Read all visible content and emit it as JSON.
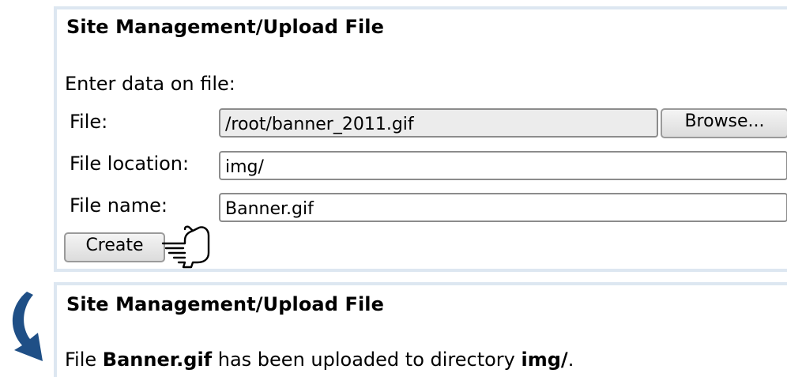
{
  "upload_panel": {
    "title": "Site Management/Upload File",
    "intro": "Enter data on file:",
    "file_label": "File:",
    "file_value": "/root/banner_2011.gif",
    "browse_label": "Browse...",
    "location_label": "File location:",
    "location_value": "img/",
    "name_label": "File name:",
    "name_value": "Banner.gif",
    "create_label": "Create"
  },
  "result_panel": {
    "title": "Site Management/Upload File",
    "msg_prefix": "File ",
    "msg_file": "Banner.gif",
    "msg_middle": " has been uploaded to directory ",
    "msg_dir": "img/",
    "msg_suffix": "."
  },
  "colors": {
    "panel_border": "#dde7f1",
    "arrow": "#1f4f86"
  },
  "icons": [
    "pointing-hand-icon",
    "curved-arrow-icon"
  ]
}
